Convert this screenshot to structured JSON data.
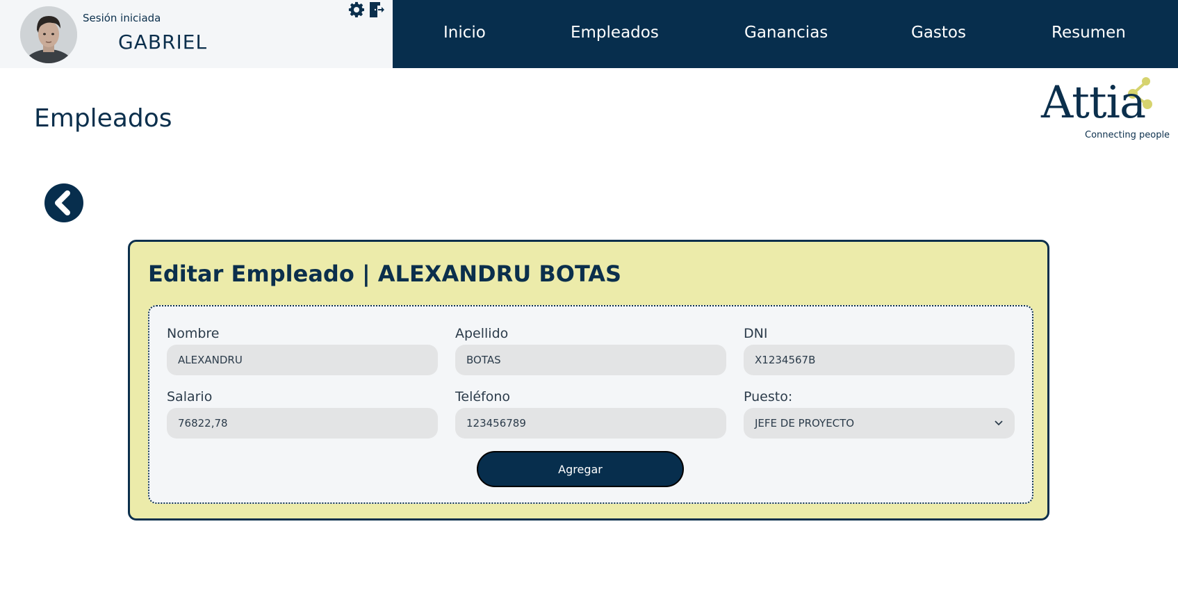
{
  "header": {
    "session_label": "Sesión iniciada",
    "user_name": "GABRIEL",
    "settings_icon": "gear-icon",
    "logout_icon": "logout-door-icon"
  },
  "nav": {
    "items": [
      {
        "label": "Inicio"
      },
      {
        "label": "Empleados"
      },
      {
        "label": "Ganancias"
      },
      {
        "label": "Gastos"
      },
      {
        "label": "Resumen"
      }
    ]
  },
  "page": {
    "title": "Empleados"
  },
  "logo": {
    "name": "Attia",
    "tagline": "Connecting people",
    "accent_color": "#d6d36e"
  },
  "back_icon": "chevron-left-icon",
  "card": {
    "title": "Editar Empleado | ALEXANDRU BOTAS"
  },
  "form": {
    "nombre": {
      "label": "Nombre",
      "value": "ALEXANDRU"
    },
    "apellido": {
      "label": "Apellido",
      "value": "BOTAS"
    },
    "dni": {
      "label": "DNI",
      "value": "X1234567B"
    },
    "salario": {
      "label": "Salario",
      "value": "76822,78"
    },
    "telefono": {
      "label": "Teléfono",
      "value": "123456789"
    },
    "puesto": {
      "label": "Puesto:",
      "value": "JEFE DE PROYECTO"
    },
    "submit_label": "Agregar"
  },
  "colors": {
    "navy": "#072e4d",
    "card_bg": "#ecebaa",
    "input_bg": "#e3e4e5"
  }
}
